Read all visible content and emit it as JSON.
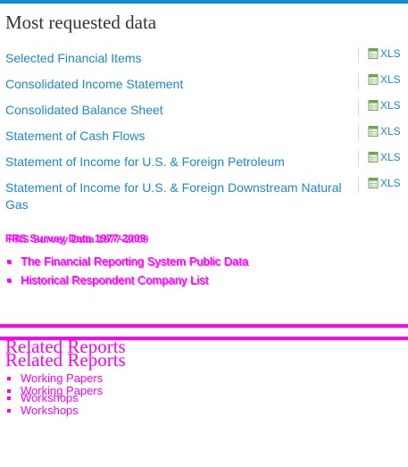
{
  "most_requested": {
    "title": "Most requested data",
    "items": [
      {
        "label": "Selected Financial Items",
        "format": "XLS"
      },
      {
        "label": "Consolidated Income Statement",
        "format": "XLS"
      },
      {
        "label": "Consolidated Balance Sheet",
        "format": "XLS"
      },
      {
        "label": "Statement of Cash Flows",
        "format": "XLS"
      },
      {
        "label": "Statement of Income for U.S. & Foreign Petroleum",
        "format": "XLS"
      },
      {
        "label": "Statement of Income for U.S. & Foreign Downstream Natural Gas",
        "format": "XLS"
      }
    ]
  },
  "frs_survey": {
    "title": "FRS Survey Data 1977-2009",
    "links": [
      "The Financial Reporting System Public Data",
      "Historical Respondent Company List"
    ]
  },
  "related_reports": {
    "title": "Related Reports",
    "links": [
      "Working Papers",
      "Workshops"
    ]
  },
  "colors": {
    "accent": "#1a8ac9",
    "top_bar": "#0f8fd6",
    "overlay": "#ff00ff",
    "title": "#333333"
  },
  "icons": {
    "xls": "spreadsheet-icon"
  }
}
